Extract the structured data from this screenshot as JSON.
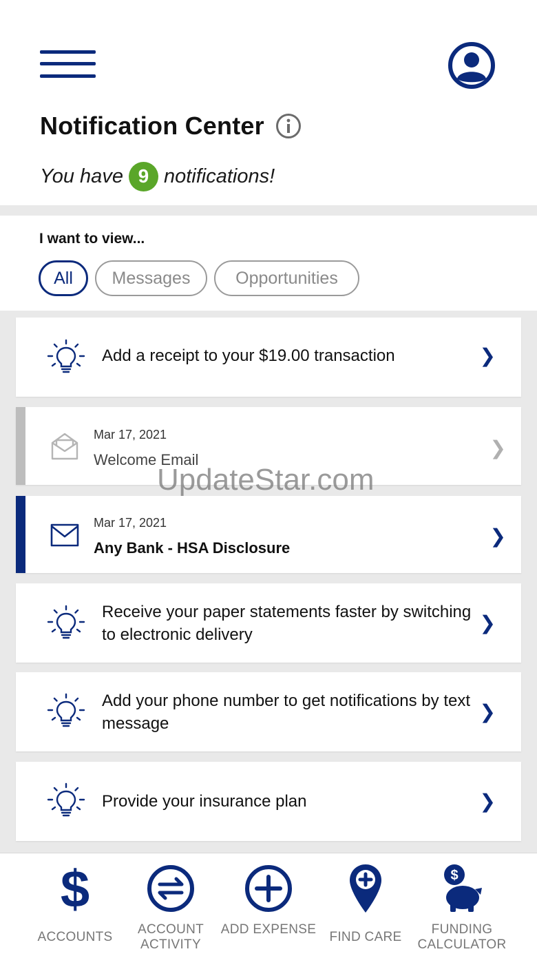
{
  "header": {
    "title": "Notification Center",
    "count_prefix": "You have",
    "count": "9",
    "count_suffix": "notifications!"
  },
  "filter": {
    "label": "I want to view...",
    "options": [
      "All",
      "Messages",
      "Opportunities"
    ],
    "selected": "All"
  },
  "notifications": [
    {
      "type": "opportunity",
      "icon": "lightbulb-icon",
      "text": "Add a receipt to your $19.00 transaction"
    },
    {
      "type": "message",
      "read": true,
      "icon": "open-envelope-icon",
      "date": "Mar 17, 2021",
      "subject": "Welcome Email"
    },
    {
      "type": "message",
      "read": false,
      "icon": "envelope-icon",
      "date": "Mar 17, 2021",
      "subject": "Any Bank - HSA Disclosure"
    },
    {
      "type": "opportunity",
      "icon": "lightbulb-icon",
      "text": "Receive your paper statements faster by switching to electronic delivery"
    },
    {
      "type": "opportunity",
      "icon": "lightbulb-icon",
      "text": "Add your phone number to get notifications by text message"
    },
    {
      "type": "opportunity",
      "icon": "lightbulb-icon",
      "text": "Provide your insurance plan"
    }
  ],
  "watermark": "UpdateStar.com",
  "tabs": [
    {
      "label": "ACCOUNTS",
      "icon": "dollar-icon"
    },
    {
      "label": "ACCOUNT ACTIVITY",
      "icon": "transfer-arrows-icon"
    },
    {
      "label": "ADD EXPENSE",
      "icon": "plus-circle-icon"
    },
    {
      "label": "FIND CARE",
      "icon": "location-pin-plus-icon"
    },
    {
      "label": "FUNDING CALCULATOR",
      "icon": "piggy-bank-icon"
    }
  ],
  "colors": {
    "brand_navy": "#0b2a7c",
    "badge_green": "#5aa629",
    "unread_stripe": "#0b2a7c",
    "read_stripe": "#bdbdbd",
    "background": "#e9e9e9"
  }
}
